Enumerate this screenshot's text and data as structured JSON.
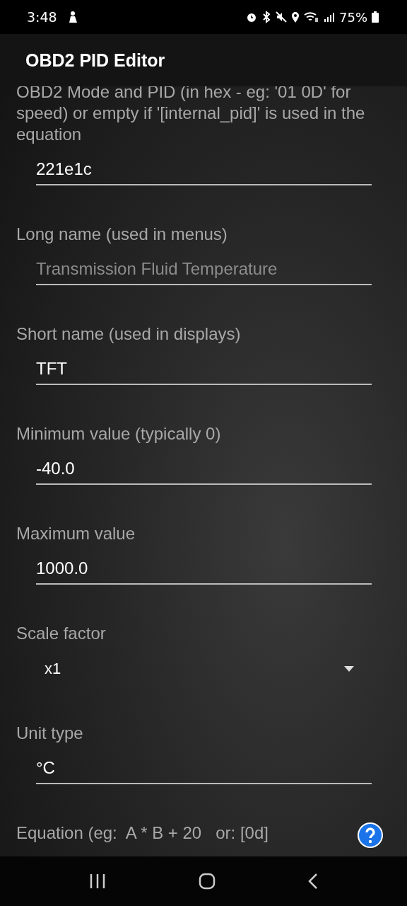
{
  "status_bar": {
    "time": "3:48",
    "battery": "75%"
  },
  "app_bar": {
    "title": "OBD2 PID Editor"
  },
  "fields": [
    {
      "kind": "text",
      "label": "OBD2 Mode and PID (in hex - eg: '01 0D' for speed) or empty if '[internal_pid]' is used in the equation",
      "value": "221e1c"
    },
    {
      "kind": "text",
      "label": "Long name (used in menus)",
      "placeholder": "Transmission Fluid Temperature"
    },
    {
      "kind": "text",
      "label": "Short name (used in displays)",
      "value": "TFT"
    },
    {
      "kind": "text",
      "label": "Minimum value (typically 0)",
      "value": "-40.0"
    },
    {
      "kind": "text",
      "label": "Maximum value",
      "value": "1000.0"
    },
    {
      "kind": "dropdown",
      "label": "Scale factor",
      "value": "x1"
    },
    {
      "kind": "text",
      "label": "Unit type",
      "value": "°C"
    }
  ],
  "equation": {
    "label": "Equation (eg:  A * B + 20   or: [0d]"
  }
}
